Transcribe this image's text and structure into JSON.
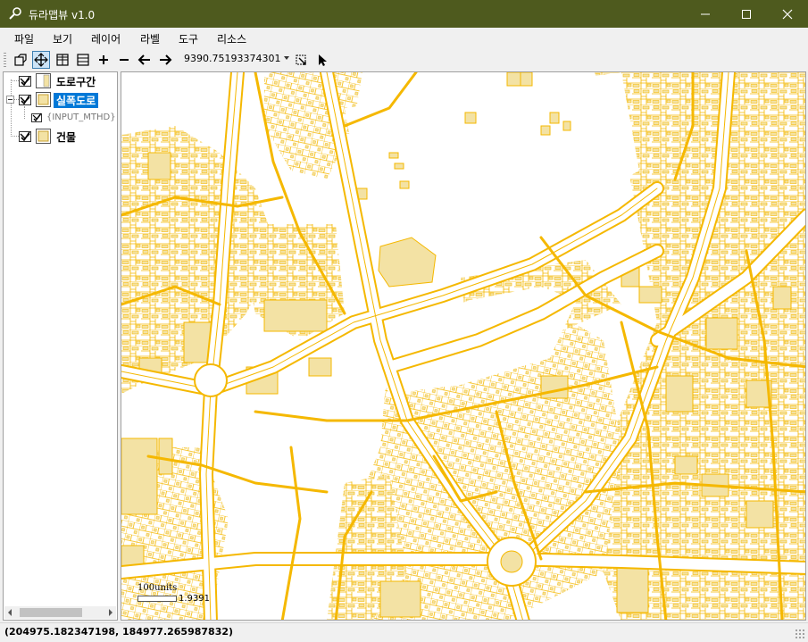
{
  "window": {
    "title": "듀라맵뷰 v1.0"
  },
  "menu": {
    "items": [
      "파일",
      "보기",
      "레이어",
      "라벨",
      "도구",
      "리소스"
    ]
  },
  "toolbar": {
    "scale_value": "9390.75193374301"
  },
  "layers": {
    "items": [
      {
        "label": "도로구간",
        "checked": true,
        "selected": false
      },
      {
        "label": "실폭도로",
        "checked": true,
        "selected": true,
        "sublabel": "{INPUT_MTHD}"
      },
      {
        "label": "건물",
        "checked": true,
        "selected": false
      }
    ]
  },
  "map": {
    "scalebar_units": "100units",
    "scalebar_ratio": "1.9391",
    "road_color": "#f5b800",
    "fill_color": "#f3e2a4"
  },
  "status": {
    "coordinates": "(204975.182347198, 184977.265987832)"
  }
}
